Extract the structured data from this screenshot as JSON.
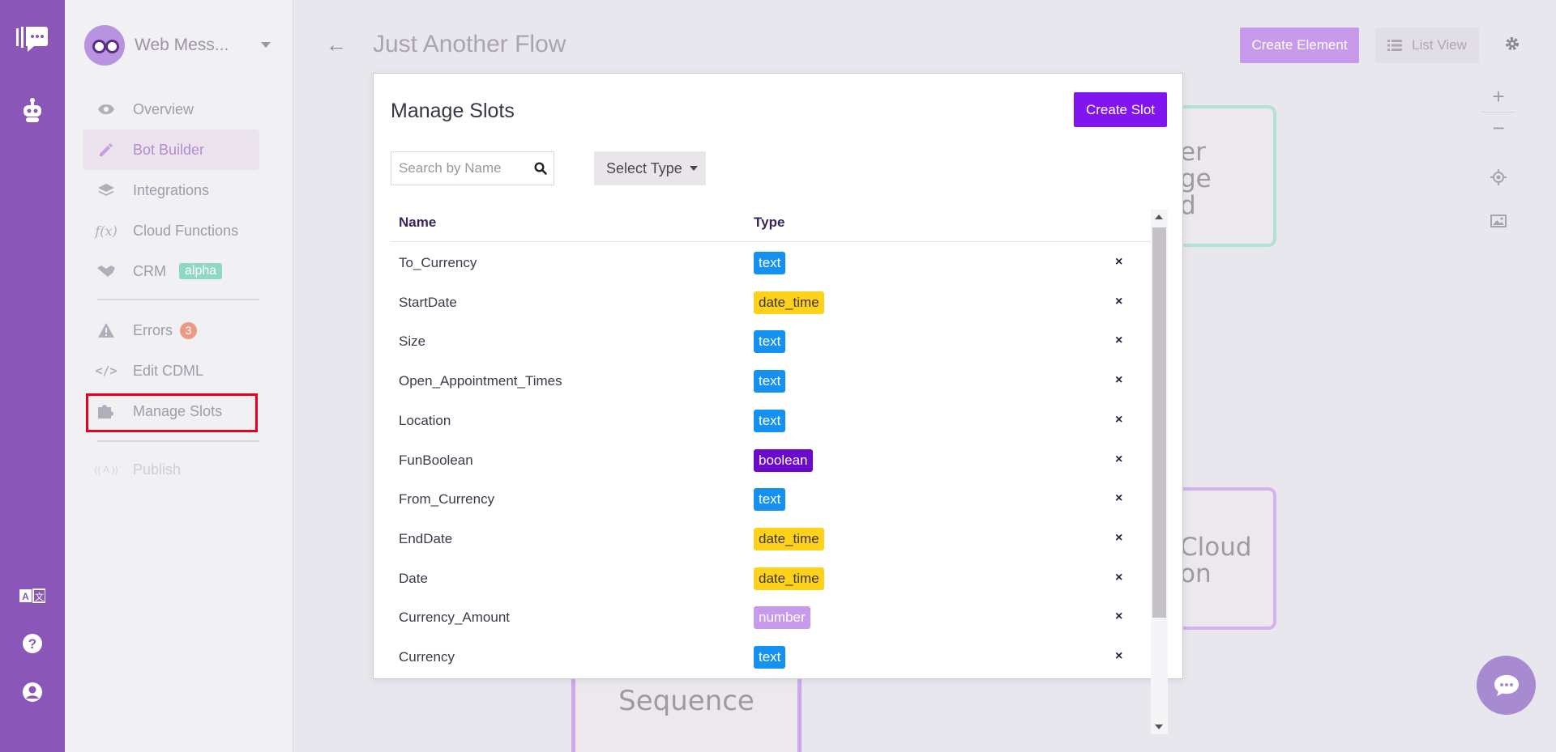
{
  "rail": {
    "icons": [
      "chat-logo-icon",
      "bot-icon",
      "translate-icon",
      "help-icon",
      "user-icon"
    ]
  },
  "sidebar": {
    "workspace_name": "Web Mess...",
    "items": [
      {
        "label": "Overview",
        "icon": "eye-icon"
      },
      {
        "label": "Bot Builder",
        "icon": "pencil-icon",
        "active": true
      },
      {
        "label": "Integrations",
        "icon": "layers-icon"
      },
      {
        "label": "Cloud Functions",
        "icon": "function-icon",
        "glyph": "f(x)"
      },
      {
        "label": "CRM",
        "icon": "handshake-icon",
        "badge": "alpha"
      },
      {
        "label": "Errors",
        "icon": "warning-icon",
        "count": "3"
      },
      {
        "label": "Edit CDML",
        "icon": "code-icon",
        "glyph": "</>"
      },
      {
        "label": "Manage Slots",
        "icon": "puzzle-icon",
        "highlighted": true
      },
      {
        "label": "Publish",
        "icon": "broadcast-icon",
        "glyph": "(( A ))"
      }
    ]
  },
  "header": {
    "title": "Just Another Flow",
    "create_element": "Create Element",
    "list_view": "List View"
  },
  "canvas": {
    "node_green_text": "er\nge\nd",
    "node_purple_text": "Cloud\non",
    "node_seq_text": "Sequence"
  },
  "modal": {
    "title": "Manage Slots",
    "create_slot": "Create Slot",
    "search_placeholder": "Search by Name",
    "select_type": "Select Type",
    "columns": {
      "name": "Name",
      "type": "Type"
    },
    "rows": [
      {
        "name": "To_Currency",
        "type": "text"
      },
      {
        "name": "StartDate",
        "type": "date_time"
      },
      {
        "name": "Size",
        "type": "text"
      },
      {
        "name": "Open_Appointment_Times",
        "type": "text"
      },
      {
        "name": "Location",
        "type": "text"
      },
      {
        "name": "FunBoolean",
        "type": "boolean"
      },
      {
        "name": "From_Currency",
        "type": "text"
      },
      {
        "name": "EndDate",
        "type": "date_time"
      },
      {
        "name": "Date",
        "type": "date_time"
      },
      {
        "name": "Currency_Amount",
        "type": "number"
      },
      {
        "name": "Currency",
        "type": "text"
      }
    ],
    "delete_glyph": "×"
  },
  "colors": {
    "rail": "#8a56b8",
    "accent": "#8115f0",
    "text_type": "#1591f2",
    "date_time_type": "#ffd21a",
    "boolean_type": "#6a0acc",
    "number_type": "#c79aeb",
    "highlight": "#e8001c"
  }
}
